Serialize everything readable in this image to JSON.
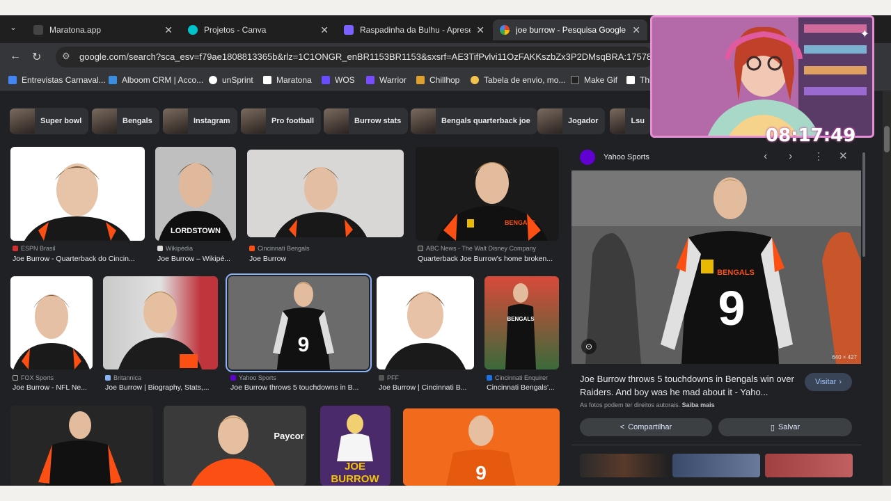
{
  "browser": {
    "tabs": [
      {
        "title": "Maratona.app",
        "color": "#3a3a3a"
      },
      {
        "title": "Projetos - Canva",
        "color": "#00c4cc"
      },
      {
        "title": "Raspadinha da Bulhu - Apresen",
        "color": "#7b61ff"
      },
      {
        "title": "joe burrow - Pesquisa Google",
        "color": "#4285f4"
      }
    ],
    "url": "google.com/search?sca_esv=f79ae1808813365b&rlz=1C1ONGR_enBR1153BR1153&sxsrf=AE3TifPvlvi11OzFAKKszbZx3P2DMsqBRA:17578562",
    "bookmarks": [
      {
        "label": "Entrevistas Carnaval...",
        "color": "#4285f4"
      },
      {
        "label": "Alboom CRM | Acco...",
        "color": "#3b8de0"
      },
      {
        "label": "unSprint",
        "color": "#ffffff"
      },
      {
        "label": "Maratona",
        "color": "#ffffff"
      },
      {
        "label": "WOS",
        "color": "#6a4cff"
      },
      {
        "label": "Warrior",
        "color": "#7a4cff"
      },
      {
        "label": "Chillhop",
        "color": "#e0a030"
      },
      {
        "label": "Tabela de envio, mo...",
        "color": "#f2c14e"
      },
      {
        "label": "Make Gif",
        "color": "#222222"
      },
      {
        "label": "Thi",
        "color": "#ffffff"
      }
    ]
  },
  "chips": [
    "Super bowl",
    "Bengals",
    "Instagram",
    "Pro football",
    "Burrow stats",
    "Bengals quarterback joe",
    "Jogador",
    "Lsu"
  ],
  "results": {
    "row1": [
      {
        "source": "ESPN Brasil",
        "title": "Joe Burrow - Quarterback do Cincin..."
      },
      {
        "source": "Wikipédia",
        "title": "Joe Burrow – Wikipé..."
      },
      {
        "source": "Cincinnati Bengals",
        "title": "Joe Burrow"
      },
      {
        "source": "ABC News - The Walt Disney Company",
        "title": "Quarterback Joe Burrow's home broken..."
      }
    ],
    "row2": [
      {
        "source": "FOX Sports",
        "title": "Joe Burrow - NFL Ne..."
      },
      {
        "source": "Britannica",
        "title": "Joe Burrow | Biography, Stats,..."
      },
      {
        "source": "Yahoo Sports",
        "title": "Joe Burrow throws 5 touchdowns in B..."
      },
      {
        "source": "PFF",
        "title": "Joe Burrow | Cincinnati B..."
      },
      {
        "source": "Cincinnati Enquirer",
        "title": "Cincinnati Bengals'..."
      }
    ],
    "row3_image_text": [
      "LORDSTOWN",
      "JOE",
      "BURROW",
      "BENGALS",
      "Paycor"
    ]
  },
  "preview": {
    "source": "Yahoo Sports",
    "dimensions": "640 × 427",
    "title": "Joe Burrow throws 5 touchdowns in Bengals win over Raiders. And boy was he mad about it - Yaho...",
    "visit_label": "Visitar",
    "rights_note": "As fotos podem ter direitos autorais.",
    "learn_more": "Saiba mais",
    "share_label": "Compartilhar",
    "save_label": "Salvar",
    "jersey_number": "9"
  },
  "overlay": {
    "timer": "08:17:49"
  },
  "colors": {
    "accent": "#8ab4f8",
    "bengals_orange": "#fb4f14",
    "bengals_black": "#111111",
    "webcam_border": "#e68fd5"
  }
}
